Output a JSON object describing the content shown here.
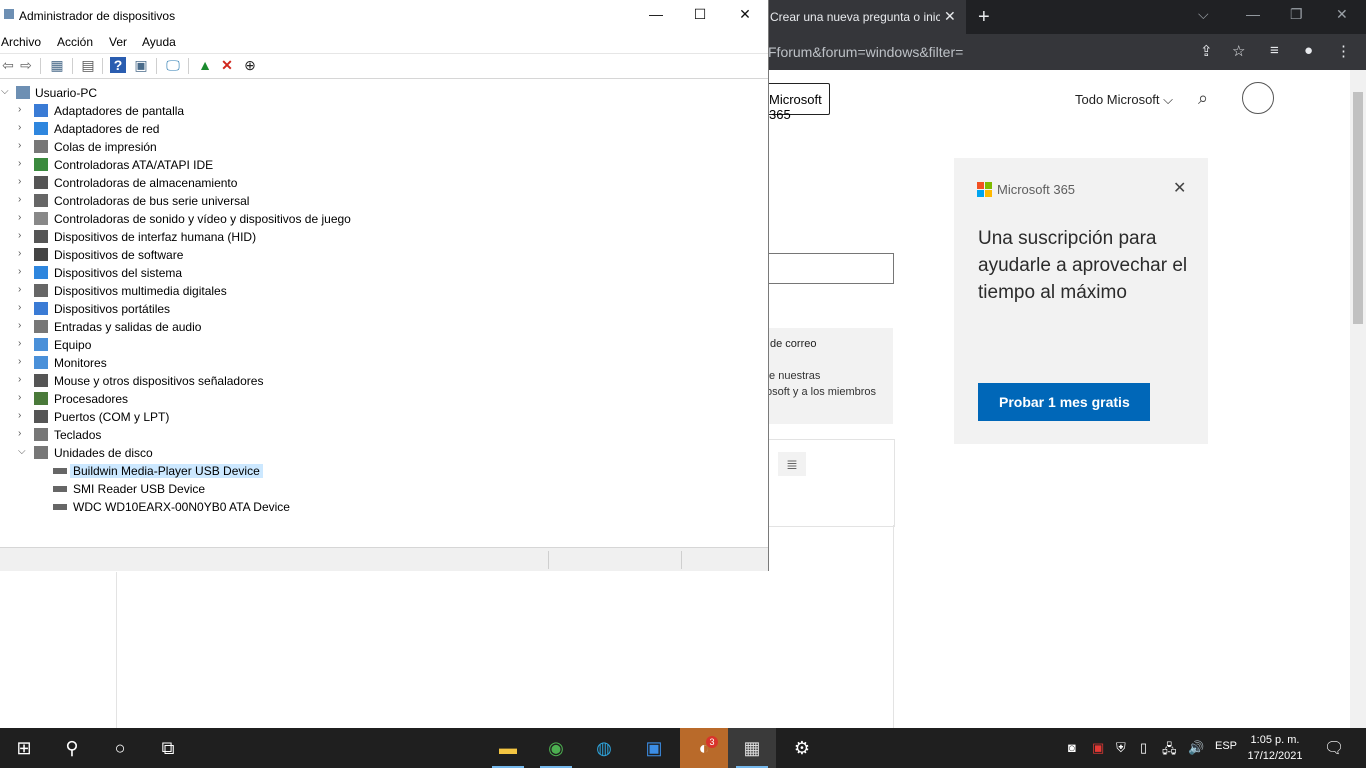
{
  "browser": {
    "tab_title": "Crear una nueva pregunta o inicia",
    "tab_close": "✕",
    "new_tab": "+",
    "url_fragment": "Fforum&forum=windows&filter=",
    "header": {
      "ms365_button": "Microsoft 365",
      "all_microsoft": "Todo Microsoft",
      "chevron": "⌵"
    },
    "gray_panel": {
      "line1": "de correo",
      "line2": "te nuestras",
      "line3": "osoft y a los miembros"
    },
    "ad": {
      "brand": "Microsoft 365",
      "close": "✕",
      "headline": "Una suscripción para ayudarle a aprovechar el tiempo al máximo",
      "cta": "Probar 1 mes gratis",
      "logo_colors": [
        "#f25022",
        "#7fba00",
        "#00a4ef",
        "#ffb900"
      ],
      "cta_color": "#0067b8"
    }
  },
  "devmgr": {
    "title": "Administrador de dispositivos",
    "controls": {
      "minimize": "—",
      "maximize": "☐",
      "close": "✕"
    },
    "menu": [
      "Archivo",
      "Acción",
      "Ver",
      "Ayuda"
    ],
    "root": "Usuario-PC",
    "categories": [
      "Adaptadores de pantalla",
      "Adaptadores de red",
      "Colas de impresión",
      "Controladoras ATA/ATAPI IDE",
      "Controladoras de almacenamiento",
      "Controladoras de bus serie universal",
      "Controladoras de sonido y vídeo y dispositivos de juego",
      "Dispositivos de interfaz humana (HID)",
      "Dispositivos de software",
      "Dispositivos del sistema",
      "Dispositivos multimedia digitales",
      "Dispositivos portátiles",
      "Entradas y salidas de audio",
      "Equipo",
      "Monitores",
      "Mouse y otros dispositivos señaladores",
      "Procesadores",
      "Puertos (COM y LPT)",
      "Teclados",
      "Unidades de disco"
    ],
    "disk_drives": [
      "Buildwin Media-Player USB Device",
      "SMI   Reader USB Device",
      "WDC WD10EARX-00N0YB0 ATA Device"
    ],
    "selected_device": "Buildwin Media-Player USB Device"
  },
  "taskbar": {
    "language": "ESP",
    "time": "1:05 p. m.",
    "date": "17/12/2021",
    "badge_count": "3"
  }
}
